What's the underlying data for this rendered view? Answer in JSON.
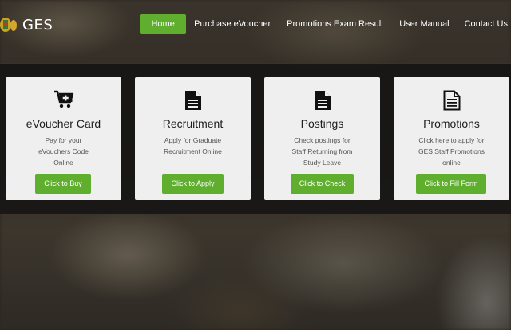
{
  "brand": {
    "name": "GES"
  },
  "nav": {
    "items": [
      {
        "label": "Home",
        "active": true
      },
      {
        "label": "Purchase eVoucher"
      },
      {
        "label": "Promotions Exam Result"
      },
      {
        "label": "User Manual"
      },
      {
        "label": "Contact Us"
      }
    ]
  },
  "cards": [
    {
      "icon": "cart-add-icon",
      "title": "eVoucher Card",
      "desc": [
        "Pay for your",
        "eVouchers Code",
        "Online"
      ],
      "button": "Click to Buy"
    },
    {
      "icon": "document-icon",
      "title": "Recruitment",
      "desc": [
        "Apply for Graduate",
        "Recruitment Online"
      ],
      "button": "Click to Apply"
    },
    {
      "icon": "document-icon",
      "title": "Postings",
      "desc": [
        "Check postings for",
        "Staff Returning from",
        "Study Leave"
      ],
      "button": "Click to Check"
    },
    {
      "icon": "document-outline-icon",
      "title": "Promotions",
      "desc": [
        "Click here to apply for",
        "GES Staff Promotions",
        "online"
      ],
      "button": "Click to Fill Form"
    }
  ],
  "colors": {
    "accent": "#5fae2e",
    "card": "#efefef"
  }
}
